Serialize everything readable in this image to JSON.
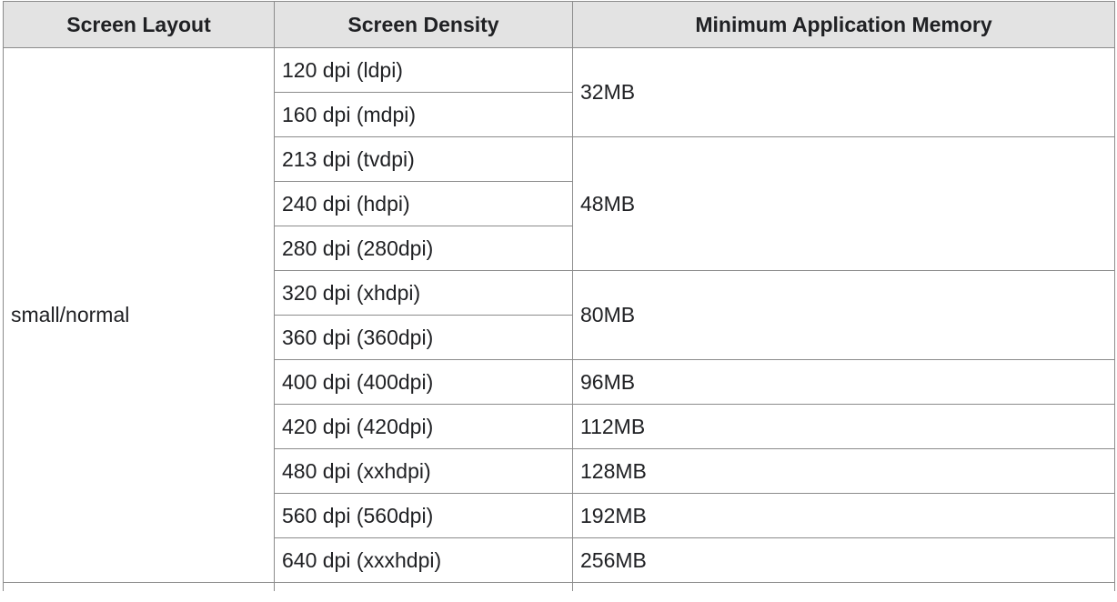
{
  "table": {
    "headers": [
      "Screen Layout",
      "Screen Density",
      "Minimum Application Memory"
    ],
    "layout": "small/normal",
    "densities": [
      "120 dpi (ldpi)",
      "160 dpi (mdpi)",
      "213 dpi (tvdpi)",
      "240 dpi (hdpi)",
      "280 dpi (280dpi)",
      "320 dpi (xhdpi)",
      "360 dpi (360dpi)",
      "400 dpi (400dpi)",
      "420 dpi (420dpi)",
      "480 dpi (xxhdpi)",
      "560 dpi (560dpi)",
      "640 dpi (xxxhdpi)"
    ],
    "memory_groups": [
      {
        "value": "32MB",
        "density_count": 2
      },
      {
        "value": "48MB",
        "density_count": 3
      },
      {
        "value": "80MB",
        "density_count": 2
      },
      {
        "value": "96MB",
        "density_count": 1
      },
      {
        "value": "112MB",
        "density_count": 1
      },
      {
        "value": "128MB",
        "density_count": 1
      },
      {
        "value": "192MB",
        "density_count": 1
      },
      {
        "value": "256MB",
        "density_count": 1
      }
    ]
  }
}
